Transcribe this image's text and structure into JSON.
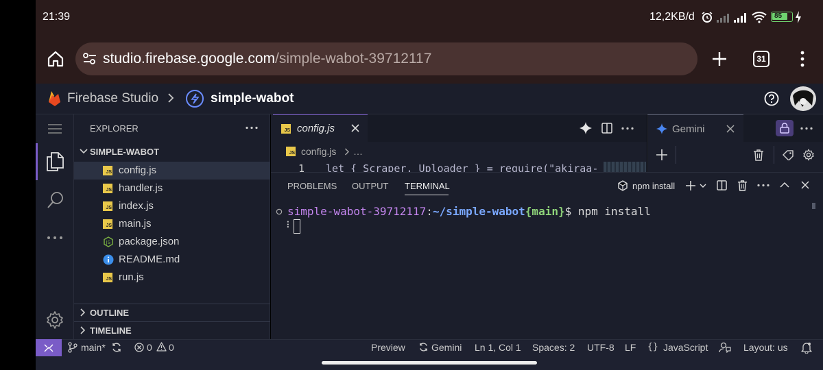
{
  "status_bar": {
    "time": "21:39",
    "network_speed": "12,2KB/d",
    "battery": "85"
  },
  "browser": {
    "url_host": "studio.firebase.google.com",
    "url_path": "/simple-wabot-39712117",
    "tab_count": "31"
  },
  "header": {
    "app_name": "Firebase Studio",
    "project_name": "simple-wabot"
  },
  "explorer": {
    "title": "EXPLORER",
    "project": "SIMPLE-WABOT",
    "files": [
      {
        "name": "config.js",
        "type": "js"
      },
      {
        "name": "handler.js",
        "type": "js"
      },
      {
        "name": "index.js",
        "type": "js"
      },
      {
        "name": "main.js",
        "type": "js"
      },
      {
        "name": "package.json",
        "type": "json"
      },
      {
        "name": "README.md",
        "type": "info"
      },
      {
        "name": "run.js",
        "type": "js"
      }
    ],
    "outline": "OUTLINE",
    "timeline": "TIMELINE"
  },
  "editor": {
    "tab": "config.js",
    "breadcrumb": "config.js",
    "breadcrumb_more": "…",
    "line_number": "1",
    "code_line": "let { Scraper, Uploader } = require(\"akiraa-"
  },
  "gemini": {
    "tab": "Gemini"
  },
  "panel": {
    "tabs": [
      "PROBLEMS",
      "OUTPUT",
      "TERMINAL"
    ],
    "active_tab": "TERMINAL",
    "terminal_name": "npm install",
    "prompt_path": "simple-wabot-39712117",
    "prompt_dir": "~/simple-wabot",
    "prompt_branch": "{main}",
    "prompt_suffix": "$ npm install",
    "spinner": "⠇"
  },
  "statusline": {
    "branch": "main*",
    "errors": "0",
    "warnings": "0",
    "preview": "Preview",
    "gemini": "Gemini",
    "position": "Ln 1, Col 1",
    "spaces": "Spaces: 2",
    "encoding": "UTF-8",
    "eol": "LF",
    "language": "JavaScript",
    "layout": "Layout: us"
  },
  "colors": {
    "accent": "#7a5cc7",
    "prompt_purple": "#c586f0",
    "prompt_blue": "#7aa8ff",
    "prompt_green": "#8fd47a",
    "background": "#1b1e2b"
  }
}
